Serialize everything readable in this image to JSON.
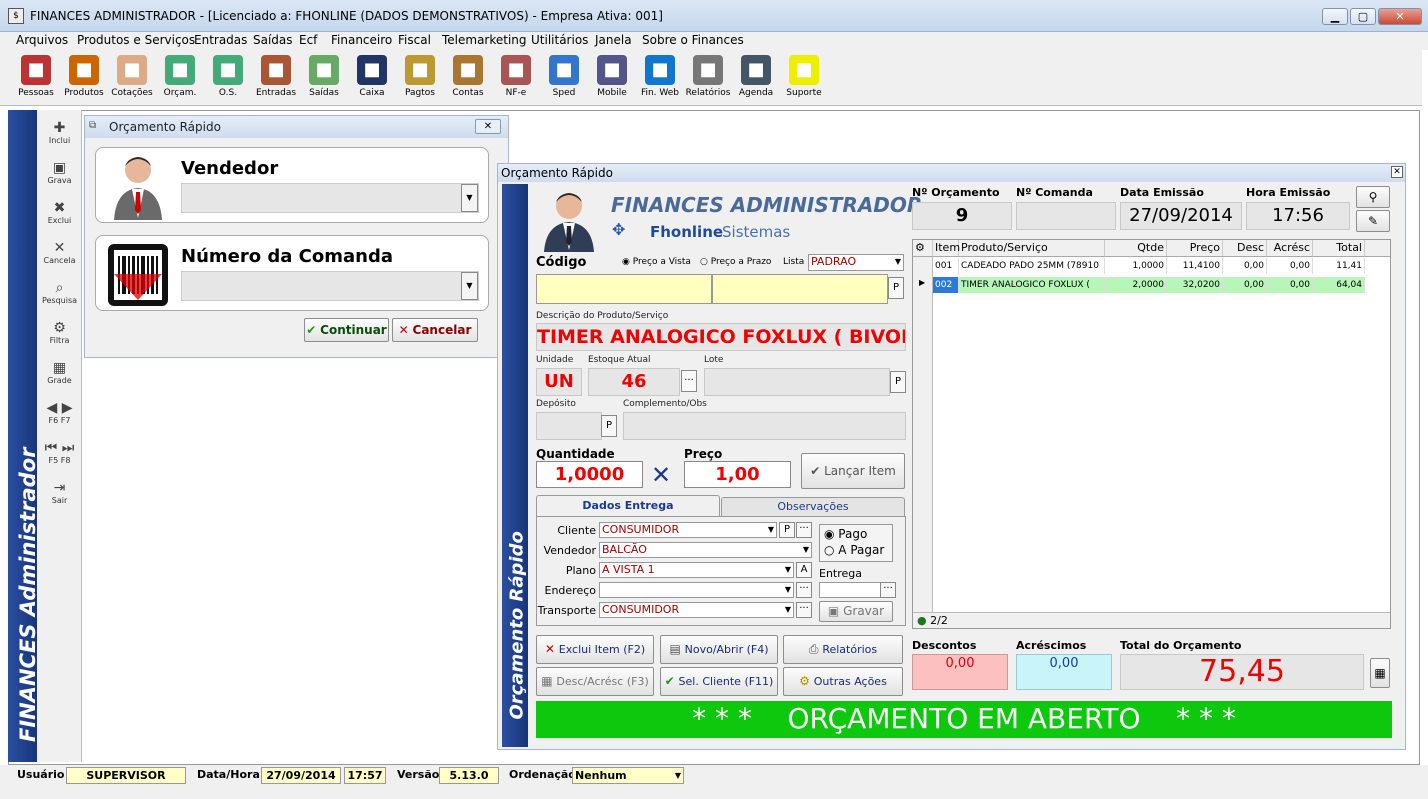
{
  "app": {
    "title": "FINANCES ADMINISTRADOR - [Licenciado a: FHONLINE (DADOS DEMONSTRATIVOS) - Empresa Ativa: 001]"
  },
  "menu": [
    "Arquivos",
    "Produtos e Serviços",
    "Entradas",
    "Saídas",
    "Ecf",
    "Financeiro",
    "Fiscal",
    "Telemarketing",
    "Utilitários",
    "Janela",
    "Sobre o Finances"
  ],
  "toolbar": [
    {
      "label": "Pessoas",
      "icon": "people-icon",
      "color": "#b33"
    },
    {
      "label": "Produtos",
      "icon": "cubes-icon",
      "color": "#c60"
    },
    {
      "label": "Cotações",
      "icon": "pen-icon",
      "color": "#da8"
    },
    {
      "label": "Orçam.",
      "icon": "calculator-icon",
      "color": "#4a7"
    },
    {
      "label": "O.S.",
      "icon": "tools-icon",
      "color": "#4a7"
    },
    {
      "label": "Entradas",
      "icon": "truck-icon",
      "color": "#a53"
    },
    {
      "label": "Saídas",
      "icon": "person-money-icon",
      "color": "#6a6"
    },
    {
      "label": "Caixa",
      "icon": "cash-register-icon",
      "color": "#236"
    },
    {
      "label": "Pagtos",
      "icon": "money-icon",
      "color": "#b93"
    },
    {
      "label": "Contas",
      "icon": "books-icon",
      "color": "#a73"
    },
    {
      "label": "NF-e",
      "icon": "nfe-icon",
      "color": "#a55"
    },
    {
      "label": "Sped",
      "icon": "monitor-icon",
      "color": "#37c"
    },
    {
      "label": "Mobile",
      "icon": "mobile-icon",
      "color": "#558"
    },
    {
      "label": "Fin. Web",
      "icon": "ie-icon",
      "color": "#17c"
    },
    {
      "label": "Relatórios",
      "icon": "printer-icon",
      "color": "#777"
    },
    {
      "label": "Agenda",
      "icon": "calendar-icon",
      "color": "#456"
    },
    {
      "label": "Suporte",
      "icon": "lightbulb-icon",
      "color": "#ee0"
    }
  ],
  "side": {
    "title": "FINANCES Administrador",
    "tools": [
      {
        "label": "Inclui",
        "glyph": "✚"
      },
      {
        "label": "Grava",
        "glyph": "▣"
      },
      {
        "label": "Exclui",
        "glyph": "✖"
      },
      {
        "label": "Cancela",
        "glyph": "✕"
      },
      {
        "label": "Pesquisa",
        "glyph": "⌕"
      },
      {
        "label": "Filtra",
        "glyph": "⚙"
      },
      {
        "label": "Grade",
        "glyph": "▦"
      },
      {
        "label": "F6   F7",
        "glyph": "◀ ▶"
      },
      {
        "label": "F5   F8",
        "glyph": "⏮ ⏭"
      },
      {
        "label": "Sair",
        "glyph": "⇥"
      }
    ]
  },
  "win1": {
    "title": "Orçamento Rápido",
    "vendedor_label": "Vendedor",
    "comanda_label": "Número da Comanda",
    "continuar": "Continuar",
    "cancelar": "Cancelar"
  },
  "win2": {
    "title": "Orçamento Rápido",
    "side_title": "Orçamento Rápido",
    "brand1": "FINANCES ADMINISTRADOR",
    "brand2a": "Fhonline",
    "brand2b": "Sistemas",
    "codigo_label": "Código",
    "preco_vista": "Preço a Vista",
    "preco_prazo": "Preço a Prazo",
    "lista_label": "Lista",
    "lista_value": "PADRAO",
    "desc_label": "Descrição do Produto/Serviço",
    "desc_value": "TIMER ANALOGICO FOXLUX ( BIVOLT",
    "unidade_label": "Unidade",
    "unidade_value": "UN",
    "estoque_label": "Estoque Atual",
    "estoque_value": "46",
    "lote_label": "Lote",
    "deposito_label": "Depósito",
    "compl_label": "Complemento/Obs",
    "qtd_label": "Quantidade",
    "qtd_value": "1,0000",
    "preco_label": "Preço",
    "preco_value": "1,00",
    "lancar": "Lançar Item",
    "tab1": "Dados Entrega",
    "tab2": "Observações",
    "cliente_label": "Cliente",
    "cliente_value": "CONSUMIDOR",
    "vendedor_label": "Vendedor",
    "vendedor_value": "BALCÃO",
    "plano_label": "Plano",
    "plano_value": "A VISTA   1",
    "endereco_label": "Endereço",
    "transporte_label": "Transporte",
    "transporte_value": "CONSUMIDOR",
    "pago": "Pago",
    "apagar": "A Pagar",
    "entrega_label": "Entrega",
    "gravar": "Gravar",
    "num_orc_label": "Nº Orçamento",
    "num_orc": "9",
    "num_comanda_label": "Nº Comanda",
    "data_label": "Data Emissão",
    "data": "27/09/2014",
    "hora_label": "Hora Emissão",
    "hora": "17:56",
    "grid_headers": [
      "Item",
      "Produto/Serviço",
      "Qtde",
      "Preço",
      "Desc",
      "Acrésc",
      "Total"
    ],
    "rows": [
      [
        "001",
        "CADEADO PADO 25MM (78910",
        "1,0000",
        "11,4100",
        "0,00",
        "0,00",
        "11,41"
      ],
      [
        "002",
        "TIMER ANALOGICO FOXLUX (",
        "2,0000",
        "32,0200",
        "0,00",
        "0,00",
        "64,04"
      ]
    ],
    "grid_count": "2/2",
    "btn_exclui": "Exclui Item (F2)",
    "btn_novo": "Novo/Abrir (F4)",
    "btn_relatorios": "Relatórios",
    "btn_desc": "Desc/Acrésc (F3)",
    "btn_selcli": "Sel. Cliente (F11)",
    "btn_outras": "Outras Ações",
    "descontos_label": "Descontos",
    "descontos": "0,00",
    "acrescimos_label": "Acréscimos",
    "acrescimos": "0,00",
    "total_label": "Total do Orçamento",
    "total": "75,45",
    "banner": "* * *    ORÇAMENTO EM ABERTO    * * *"
  },
  "status": {
    "usuario_label": "Usuário",
    "usuario": "SUPERVISOR",
    "datahora_label": "Data/Hora",
    "data": "27/09/2014",
    "hora": "17:57",
    "versao_label": "Versão",
    "versao": "5.13.0",
    "ordenacao_label": "Ordenação",
    "ordenacao": "Nenhum"
  }
}
